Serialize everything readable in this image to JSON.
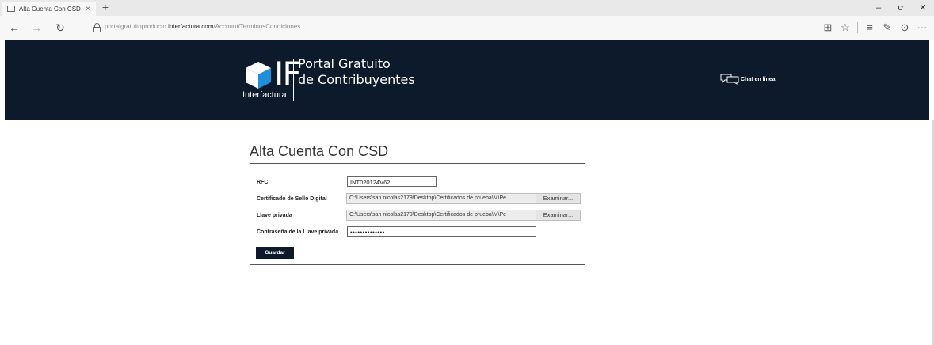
{
  "browser": {
    "tab_title": "Alta Cuenta Con CSD",
    "tab_close": "×",
    "new_tab": "+",
    "window_controls": {
      "minimize": "–",
      "maximize": "ơ",
      "close": "✕"
    },
    "nav": {
      "back": "←",
      "forward": "→",
      "refresh": "↻"
    },
    "url": {
      "prefix": "portalgratuitoproducto.",
      "domain": "interfactura.com",
      "path": "/Account/TerminosCondiciones"
    },
    "tools": {
      "reading_view": "⊞",
      "favorite": "☆",
      "hub": "≡",
      "notes": "✎",
      "share": "⊙",
      "more": "···"
    }
  },
  "header": {
    "logo_letters": "IF",
    "logo_word": "Interfactura",
    "portal_line1": "Portal Gratuito",
    "portal_line2": "de Contribuyentes",
    "chat_label": "Chat en línea",
    "background_color": "#0c1a2b",
    "accent_color": "#1e8fd8"
  },
  "page": {
    "title": "Alta Cuenta Con CSD"
  },
  "form": {
    "rfc": {
      "label": "RFC",
      "value": "INT020124V62"
    },
    "certificado": {
      "label": "Certificado de Sello Digital",
      "value": "C:\\Users\\san nicolas2179\\Desktop\\Certificados de prueba\\M\\Pe",
      "browse_label": "Examinar..."
    },
    "llave": {
      "label": "Llave privada",
      "value": "C:\\Users\\san nicolas2179\\Desktop\\Certificados de prueba\\M\\Pe",
      "browse_label": "Examinar..."
    },
    "contrasena": {
      "label": "Contraseña de la Llave privada",
      "value": "••••••••••••••"
    },
    "save_label": "Guardar"
  }
}
